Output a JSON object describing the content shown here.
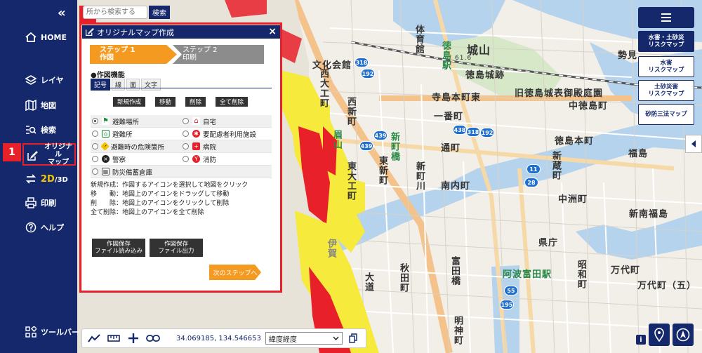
{
  "sidebar": {
    "collapse": "«",
    "items": [
      {
        "label": "HOME"
      },
      {
        "label": "レイヤ"
      },
      {
        "label": "地図"
      },
      {
        "label": "検索"
      },
      {
        "label_line1": "オリジナル",
        "label_line2": "マップ"
      },
      {
        "label_2d": "2D",
        "label_3d": "/3D"
      },
      {
        "label": "印刷"
      },
      {
        "label": "ヘルプ"
      },
      {
        "label": "ツールバー"
      }
    ]
  },
  "annotations": [
    "1",
    "1"
  ],
  "search": {
    "placeholder": "所から検索する",
    "button": "検索"
  },
  "panel": {
    "title": "オリジナルマップ作成",
    "close": "×",
    "step1": {
      "line1": "ステップ 1",
      "line2": "作図"
    },
    "step2": {
      "line1": "ステップ 2",
      "line2": "印刷"
    },
    "section": "●作図機能",
    "tabs": [
      "記号",
      "線",
      "面",
      "文字"
    ],
    "actions": [
      "新規作成",
      "移動",
      "削除",
      "全て削除"
    ],
    "symbols": [
      {
        "left": "避難場所",
        "right": "自宅"
      },
      {
        "left": "避難所",
        "right": "要配慮者利用施設"
      },
      {
        "left": "避難時の危険箇所",
        "right": "病院"
      },
      {
        "left": "警察",
        "right": "消防"
      },
      {
        "left": "防災備蓄倉庫",
        "right": ""
      }
    ],
    "help": [
      "新規作成：作図するアイコンを選択して地図をクリック",
      "移　　動：地図上のアイコンをドラッグして移動",
      "削　　除：地図上のアイコンをクリックして削除",
      "全て削除：地図上のアイコンを全て削除"
    ],
    "save_buttons": [
      {
        "line1": "作図保存",
        "line2": "ファイル読み込み"
      },
      {
        "line1": "作図保存",
        "line2": "ファイル出力"
      }
    ],
    "next": "次のステップへ"
  },
  "right_panel": {
    "buttons": [
      {
        "line1": "水害・土砂災",
        "line2": "リスクマップ"
      },
      {
        "line1": "水害",
        "line2": "リスクマップ"
      },
      {
        "line1": "土砂災害",
        "line2": "リスクマップ"
      },
      {
        "line1": "砂防三法マップ",
        "line2": ""
      }
    ]
  },
  "toolbar": {
    "coords": "34.069185, 134.546653",
    "coord_mode": "緯度経度"
  },
  "map": {
    "labels": [
      "城山",
      "徳島城跡",
      "旧徳島城表御殿庭園",
      "中徳島町",
      "徳島本町",
      "新蔵町",
      "中洲町",
      "福島",
      "新南福島",
      "寺島本町東",
      "一番町",
      "通町",
      "南内町",
      "文化会館",
      "西大工町",
      "西新町",
      "東大工町",
      "東新町",
      "新町川",
      "眉山",
      "県庁",
      "富田橋",
      "秋田町",
      "大道",
      "明神町",
      "阿波富田駅",
      "昭和町",
      "万代町",
      "万代町（五）",
      "徳島駅",
      "体育館",
      "新町橋",
      "勢見",
      "伊賀"
    ],
    "shields": [
      "318",
      "192",
      "439",
      "438",
      "318",
      "192",
      "11",
      "28",
      "55",
      "195",
      "439"
    ],
    "elevation": "61.6"
  }
}
